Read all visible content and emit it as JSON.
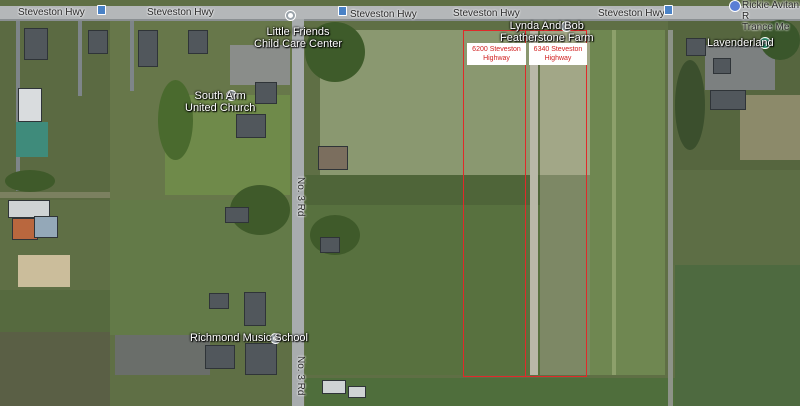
{
  "map": {
    "road_labels": {
      "steveston_1": "Steveston Hwy",
      "steveston_2": "Steveston Hwy",
      "steveston_3": "Steveston Hwy",
      "steveston_4": "Steveston Hwy",
      "steveston_5": "Steveston Hwy",
      "no3_upper": "No. 3 Rd",
      "no3_lower": "No. 3 Rd"
    },
    "places": {
      "little_friends": "Little Friends\nChild Care Center",
      "south_arm_church": "South Arm\nUnited Church",
      "richmond_music": "Richmond Music School",
      "featherstone": "Lynda And Bob\nFeatherstone Farm",
      "lavenderland": "Lavenderland",
      "rickie_avitan": "Rickie Avitan R\nTrance Me"
    },
    "parcels": [
      {
        "label": "6200 Steveston\nHighway"
      },
      {
        "label": "6340 Steveston\nHighway"
      }
    ],
    "icons": {
      "bus_stop": "bus-stop-icon",
      "place_pin": "place-pin-icon",
      "park": "park-icon"
    },
    "colors": {
      "parcel_outline": "#e02a2a",
      "road": "#9ea3a6",
      "field_green": "#6d7f4f"
    }
  }
}
